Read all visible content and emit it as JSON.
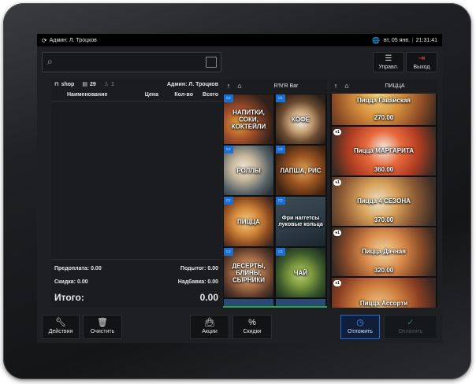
{
  "statusbar": {
    "user": "Админ: Л. Троцков",
    "date": "вт, 05 янв.",
    "time": "21:31:41"
  },
  "search": {
    "value": "",
    "placeholder": ""
  },
  "topbar": {
    "manage_label": "Управл.",
    "exit_label": "Выход"
  },
  "order": {
    "shop": "shop",
    "table": "29",
    "guests": "1",
    "admin": "Админ: Л. Троцков",
    "columns": [
      "Наименование",
      "Цена",
      "Кол-во",
      "Всего"
    ],
    "prepay_label": "Предоплата:",
    "prepay_value": "0.00",
    "subtotal_label": "Подытог:",
    "subtotal_value": "0.00",
    "discount_label": "Скидка:",
    "discount_value": "0.00",
    "markup_label": "Надбавка:",
    "markup_value": "0.00",
    "total_label": "Итого:",
    "total_value": "0.00"
  },
  "categories": {
    "title": "R'N'R Bar",
    "items": [
      {
        "label": "НАПИТКИ, СОКИ, КОКТЕЙЛИ"
      },
      {
        "label": "КОФЕ"
      },
      {
        "label": "РОЛЛЫ"
      },
      {
        "label": "ЛАПША, РИС"
      },
      {
        "label": "ПИЦЦА"
      },
      {
        "label": "Фри наггетсы луковые кольца"
      },
      {
        "label": "ДЕСЕРТЫ, БЛИНЫ, СЫРНИКИ"
      },
      {
        "label": "ЧАЙ"
      }
    ]
  },
  "products": {
    "title": "ПИЦЦА",
    "items": [
      {
        "name": "Пицца Гавайская",
        "price": "270.00"
      },
      {
        "name": "Пицца МАРГАРИТА",
        "price": "360.00"
      },
      {
        "name": "Пицца 4 СЕЗОНА",
        "price": "370.00"
      },
      {
        "name": "Пицца Дачная",
        "price": "320.00"
      },
      {
        "name": "Пицца Ассорти",
        "price": ""
      }
    ]
  },
  "bottom": {
    "actions_label": "Действия",
    "clear_label": "Очистить",
    "promos_label": "Акции",
    "discounts_label": "Скидки",
    "postpone_label": "Отложить",
    "pay_label": "Оплатить"
  },
  "colors": {
    "folder_badge": "#1c6fd1",
    "postpone_accent": "#1d6fd6",
    "pay_disabled": "#2f7a4d",
    "category_underline": "#2aa04a"
  },
  "icons": {
    "sync": "sync-icon",
    "globe": "globe-icon",
    "search": "search-icon",
    "menu": "menu-icon",
    "exit": "exit-icon",
    "back": "arrow-up-icon",
    "home": "home-icon",
    "wrench": "wrench-icon",
    "trash": "trash-icon",
    "bag": "bag-icon",
    "percent": "percent-icon",
    "clock": "clock-icon",
    "check": "check-icon"
  }
}
